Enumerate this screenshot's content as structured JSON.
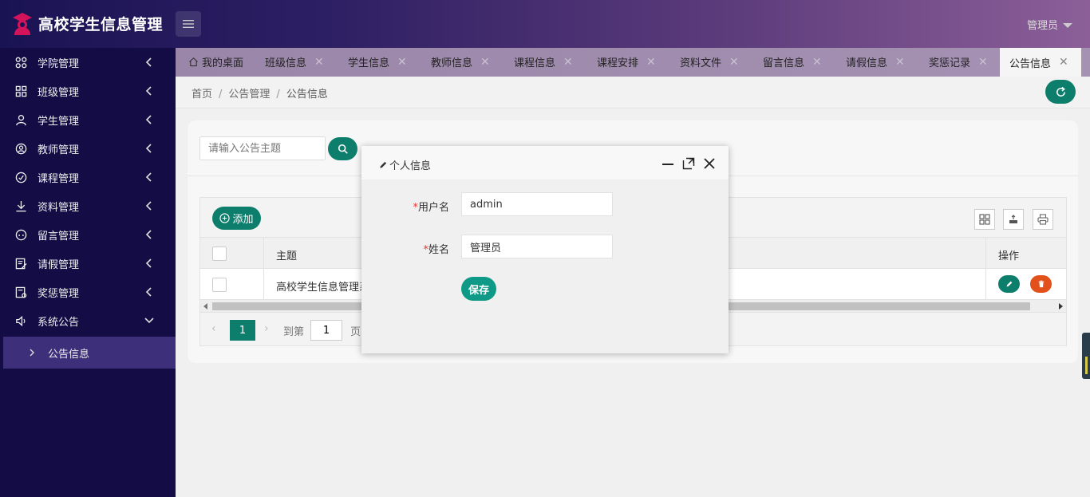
{
  "app": {
    "title": "高校学生信息管理",
    "user": "管理员"
  },
  "sidebar": {
    "items": [
      {
        "label": "学院管理",
        "icon": "grid-icon"
      },
      {
        "label": "班级管理",
        "icon": "apps-icon"
      },
      {
        "label": "学生管理",
        "icon": "user-icon"
      },
      {
        "label": "教师管理",
        "icon": "user-circle-icon"
      },
      {
        "label": "课程管理",
        "icon": "compass-icon"
      },
      {
        "label": "资料管理",
        "icon": "download-icon"
      },
      {
        "label": "留言管理",
        "icon": "chat-icon"
      },
      {
        "label": "请假管理",
        "icon": "form-icon"
      },
      {
        "label": "奖惩管理",
        "icon": "award-icon"
      },
      {
        "label": "系统公告",
        "icon": "speaker-icon"
      }
    ],
    "sub_item": "公告信息"
  },
  "tabs": [
    {
      "label": "我的桌面"
    },
    {
      "label": "班级信息"
    },
    {
      "label": "学生信息"
    },
    {
      "label": "教师信息"
    },
    {
      "label": "课程信息"
    },
    {
      "label": "课程安排"
    },
    {
      "label": "资料文件"
    },
    {
      "label": "留言信息"
    },
    {
      "label": "请假信息"
    },
    {
      "label": "奖惩记录"
    },
    {
      "label": "公告信息"
    }
  ],
  "breadcrumb": {
    "home": "首页",
    "parent": "公告管理",
    "current": "公告信息"
  },
  "search": {
    "placeholder": "请输入公告主题"
  },
  "toolbar": {
    "add_label": "添加"
  },
  "table": {
    "col_subject": "主题",
    "col_action": "操作",
    "rows": [
      {
        "subject": "高校学生信息管理系"
      }
    ]
  },
  "pager": {
    "current": "1",
    "goto_label": "到第",
    "goto_value": "1",
    "page_unit": "页"
  },
  "dialog": {
    "title": "个人信息",
    "username_label": "用户名",
    "username_value": "admin",
    "name_label": "姓名",
    "name_value": "管理员",
    "save_label": "保存",
    "required_mark": "*"
  },
  "colors": {
    "primary": "#0e7e6c",
    "danger": "#e2501b",
    "sidebar": "#130c45"
  }
}
